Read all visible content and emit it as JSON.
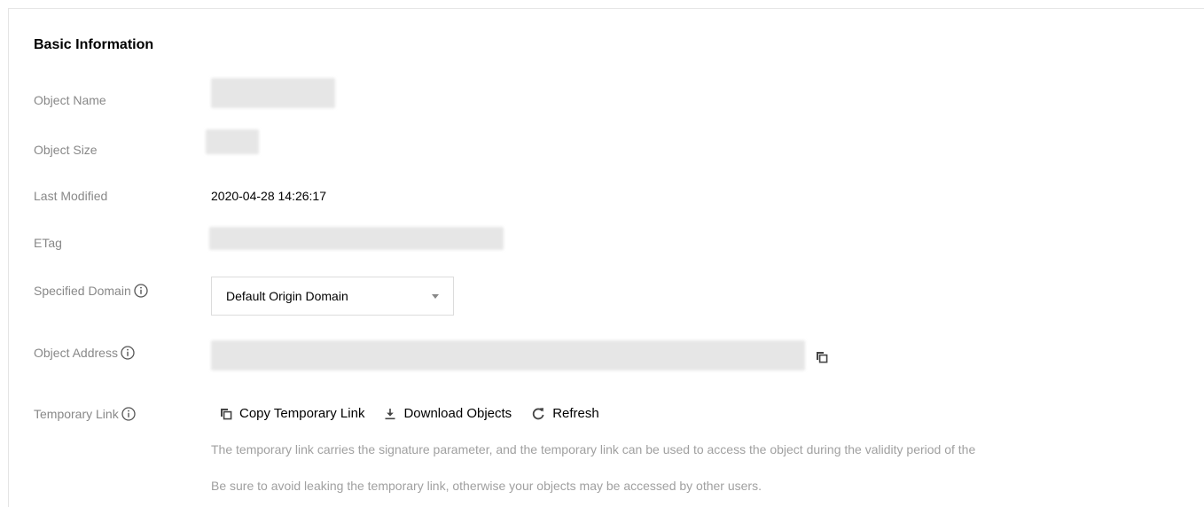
{
  "section_title": "Basic Information",
  "fields": {
    "object_name": {
      "label": "Object Name"
    },
    "object_size": {
      "label": "Object Size"
    },
    "last_modified": {
      "label": "Last Modified",
      "value": "2020-04-28 14:26:17"
    },
    "etag": {
      "label": "ETag"
    },
    "specified_domain": {
      "label": "Specified Domain",
      "selected": "Default Origin Domain"
    },
    "object_address": {
      "label": "Object Address"
    },
    "temporary_link": {
      "label": "Temporary Link"
    }
  },
  "actions": {
    "copy": "Copy Temporary Link",
    "download": "Download Objects",
    "refresh": "Refresh"
  },
  "hints": {
    "line1": "The temporary link carries the signature parameter, and the temporary link can be used to access the object during the validity period of the",
    "line2": "Be sure to avoid leaking the temporary link, otherwise your objects may be accessed by other users."
  },
  "icons": {
    "info": "info-circle-icon",
    "copy": "copy-icon",
    "download": "download-icon",
    "refresh": "refresh-icon",
    "dropdown": "caret-down-icon"
  }
}
